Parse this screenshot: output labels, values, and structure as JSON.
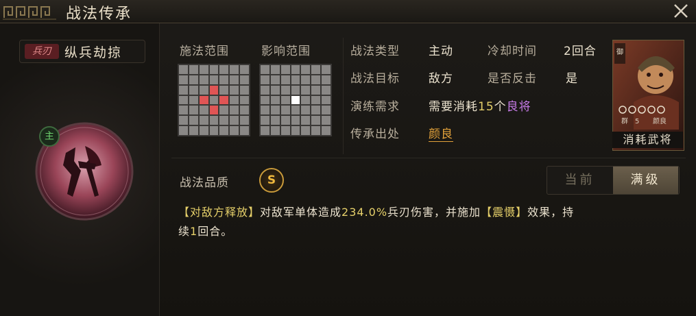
{
  "window": {
    "title": "战法传承"
  },
  "skill": {
    "type_badge": "兵刃",
    "name": "纵兵劫掠",
    "main_badge": "主"
  },
  "ranges": {
    "cast_label": "施法范围",
    "effect_label": "影响范围",
    "cast_cells": [
      "2-3",
      "3-2",
      "3-4",
      "4-3"
    ],
    "effect_cells": [
      "3-3"
    ]
  },
  "info": {
    "skill_type_label": "战法类型",
    "skill_type_value": "主动",
    "cooldown_label": "冷却时间",
    "cooldown_value": "2回合",
    "target_label": "战法目标",
    "target_value": "敌方",
    "counter_label": "是否反击",
    "counter_value": "是",
    "train_label": "演练需求",
    "train_prefix": "需要消耗",
    "train_count": "15",
    "train_unit": "个",
    "train_general": "良将",
    "source_label": "传承出处",
    "source_value": "颜良"
  },
  "general_card": {
    "caption": "消耗武将",
    "faction": "御",
    "cost_label": "群",
    "cost": "5",
    "name": "颜良",
    "stars": 5
  },
  "quality": {
    "label": "战法品质",
    "grade": "S"
  },
  "tabs": {
    "current": "当前",
    "max": "满级"
  },
  "description": {
    "tag": "【对敌方释放】",
    "text1": "对敌军单体造成",
    "value": "234.0%",
    "text2": "兵刃伤害，并施加",
    "effect": "【震慑】",
    "text3": "效果，持续",
    "turns": "1",
    "text4": "回合。"
  },
  "colors": {
    "accent_gold": "#e6d06a",
    "link_orange": "#e3a23a",
    "general_purple": "#c77be8",
    "range_red": "#e05555"
  }
}
